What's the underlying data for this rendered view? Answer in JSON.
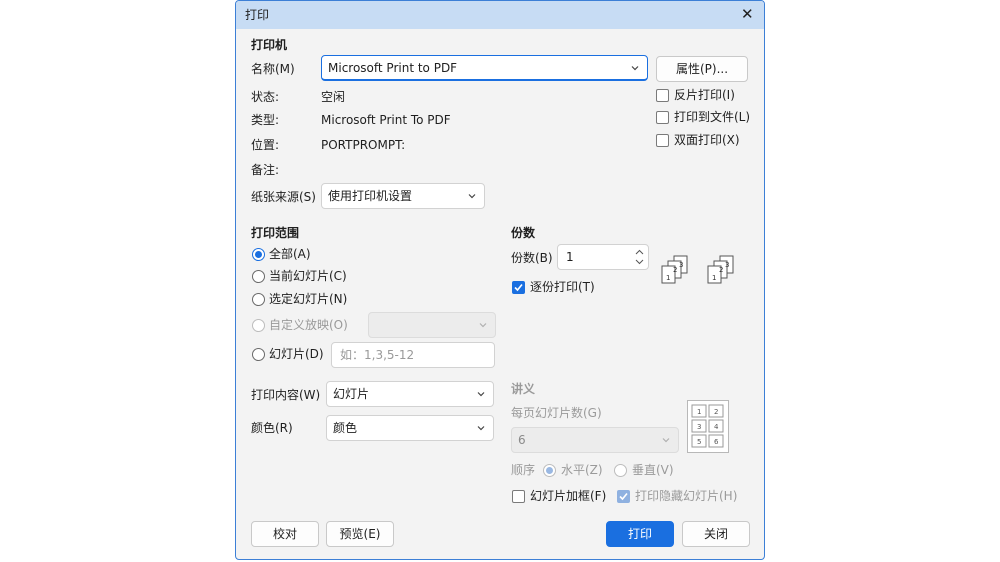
{
  "window": {
    "title": "打印",
    "close": "✕"
  },
  "printer": {
    "section_title": "打印机",
    "name_label": "名称(M)",
    "name_value": "Microsoft Print to PDF",
    "properties_button": "属性(P)...",
    "status_label": "状态:",
    "status_value": "空闲",
    "type_label": "类型:",
    "type_value": "Microsoft Print To PDF",
    "location_label": "位置:",
    "location_value": "PORTPROMPT:",
    "comment_label": "备注:",
    "reverse_print": {
      "label": "反片打印(I)",
      "checked": false
    },
    "print_to_file": {
      "label": "打印到文件(L)",
      "checked": false
    },
    "duplex": {
      "label": "双面打印(X)",
      "checked": false
    },
    "paper_source_label": "纸张来源(S)",
    "paper_source_value": "使用打印机设置"
  },
  "range": {
    "section_title": "打印范围",
    "all": "全部(A)",
    "current": "当前幻灯片(C)",
    "selection": "选定幻灯片(N)",
    "custom": "自定义放映(O)",
    "slides": "幻灯片(D)",
    "slides_placeholder": "如：1,3,5-12",
    "selected": "all"
  },
  "copies": {
    "section_title": "份数",
    "count_label": "份数(B)",
    "count_value": "1",
    "collate_label": "逐份打印(T)",
    "collate_checked": true
  },
  "content": {
    "print_what_label": "打印内容(W)",
    "print_what_value": "幻灯片",
    "color_label": "颜色(R)",
    "color_value": "颜色"
  },
  "handouts": {
    "section_title": "讲义",
    "per_page_label": "每页幻灯片数(G)",
    "per_page_value": "6",
    "order_label": "顺序",
    "horizontal": "水平(Z)",
    "vertical": "垂直(V)",
    "preview_numbers": [
      "1",
      "2",
      "3",
      "4",
      "5",
      "6"
    ]
  },
  "options": {
    "frame_label": "幻灯片加框(F)",
    "frame_checked": false,
    "hidden_label": "打印隐藏幻灯片(H)",
    "hidden_checked": true
  },
  "buttons": {
    "check": "校对",
    "preview": "预览(E)",
    "print": "打印",
    "close": "关闭"
  },
  "colors": {
    "accent": "#1a6fe0",
    "title_bar": "#c7dcf4",
    "dialog_bg": "#f3f3f3"
  }
}
